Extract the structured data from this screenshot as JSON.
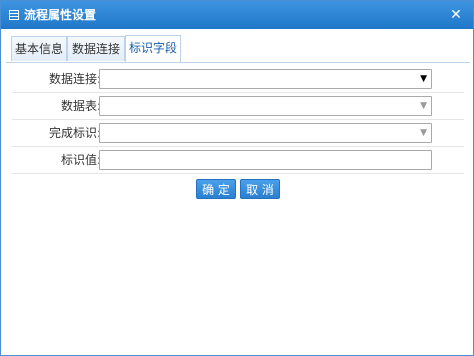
{
  "dialog": {
    "title": "流程属性设置",
    "close_symbol": "✕"
  },
  "tabs": [
    {
      "label": "基本信息",
      "active": false
    },
    {
      "label": "数据连接",
      "active": false
    },
    {
      "label": "标识字段",
      "active": true
    }
  ],
  "form": {
    "fields": [
      {
        "label": "数据连接:",
        "type": "select",
        "value": ""
      },
      {
        "label": "数据表:",
        "type": "select",
        "value": ""
      },
      {
        "label": "完成标识:",
        "type": "select",
        "value": ""
      },
      {
        "label": "标识值:",
        "type": "text",
        "value": ""
      }
    ]
  },
  "buttons": {
    "confirm_label": "确 定",
    "cancel_label": "取 消"
  },
  "colors": {
    "titlebar": "#2a85d6",
    "button": "#3a90e0",
    "tab_border": "#bcd3ea"
  },
  "icons": {
    "title_icon": "table-icon",
    "select_arrow": "chevron-down-icon"
  }
}
